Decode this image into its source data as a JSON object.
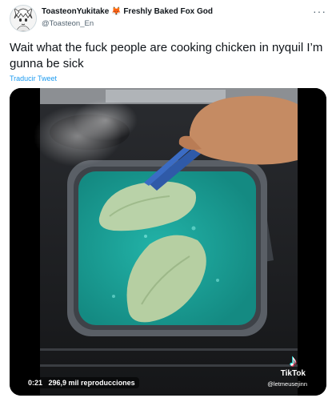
{
  "author": {
    "display_name": "ToasteonYukitake",
    "fox_emoji": "🦊",
    "name_suffix": "Freshly Baked Fox God",
    "handle": "@Toasteon_En",
    "avatar_icon": "anime-avatar-icon"
  },
  "menu": {
    "more_label": "···"
  },
  "tweet": {
    "text": "Wait what the fuck people are cooking chicken in nyquil I’m gunna be sick",
    "translate_label": "Traducir Tweet"
  },
  "video": {
    "timestamp": "0:21",
    "views": "296,9 mil reproducciones",
    "watermark_brand": "TikTok",
    "watermark_user": "@letmeusejinn",
    "liquid_color": "#1fa39a",
    "pan_color": "#4a4f55"
  }
}
